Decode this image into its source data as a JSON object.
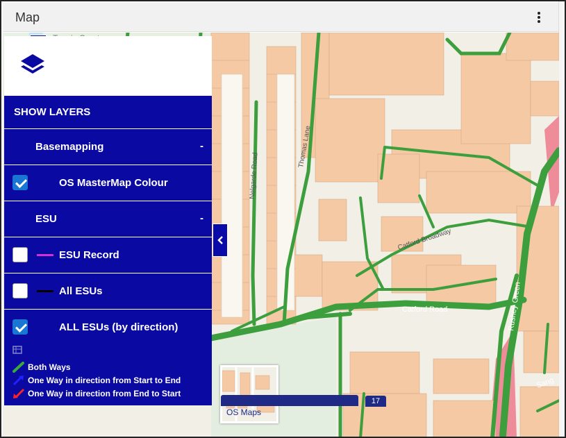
{
  "window": {
    "title": "Map"
  },
  "map": {
    "labels": {
      "tennis_court": "Tennis Court",
      "nelgarde_road": "Nelgarde Road",
      "thomas_lane": "Thomas Lane",
      "catford_broadway": "Catford Broadway",
      "catford_road": "Catford Road",
      "rushey_green": "Rushey Green",
      "road_fragment": "Sang"
    },
    "thumbnail_label": "OS Maps",
    "zoom_level": "17"
  },
  "panel": {
    "header": "SHOW LAYERS",
    "groups": [
      {
        "label": "Basemapping",
        "toggle": "-",
        "layers": [
          {
            "label": "OS MasterMap Colour",
            "checked": true,
            "swatch": ""
          }
        ]
      },
      {
        "label": "ESU",
        "toggle": "-",
        "layers": [
          {
            "label": "ESU Record",
            "checked": false,
            "swatch": "#d32fd3"
          },
          {
            "label": "All ESUs",
            "checked": false,
            "swatch": "#000000"
          },
          {
            "label": "ALL ESUs (by direction)",
            "checked": true,
            "swatch": ""
          }
        ]
      }
    ],
    "legend": [
      {
        "label": "Both Ways",
        "color": "#3aaa3a"
      },
      {
        "label": "One Way in direction from Start to End",
        "color": "#2222ff"
      },
      {
        "label": "One Way in direction from End to Start",
        "color": "#ff2222"
      }
    ]
  },
  "colors": {
    "panel_bg": "#0a0aa3",
    "road_green": "#3c9e3c",
    "building": "#f5c9a4",
    "accent_blue": "#1976d2"
  }
}
